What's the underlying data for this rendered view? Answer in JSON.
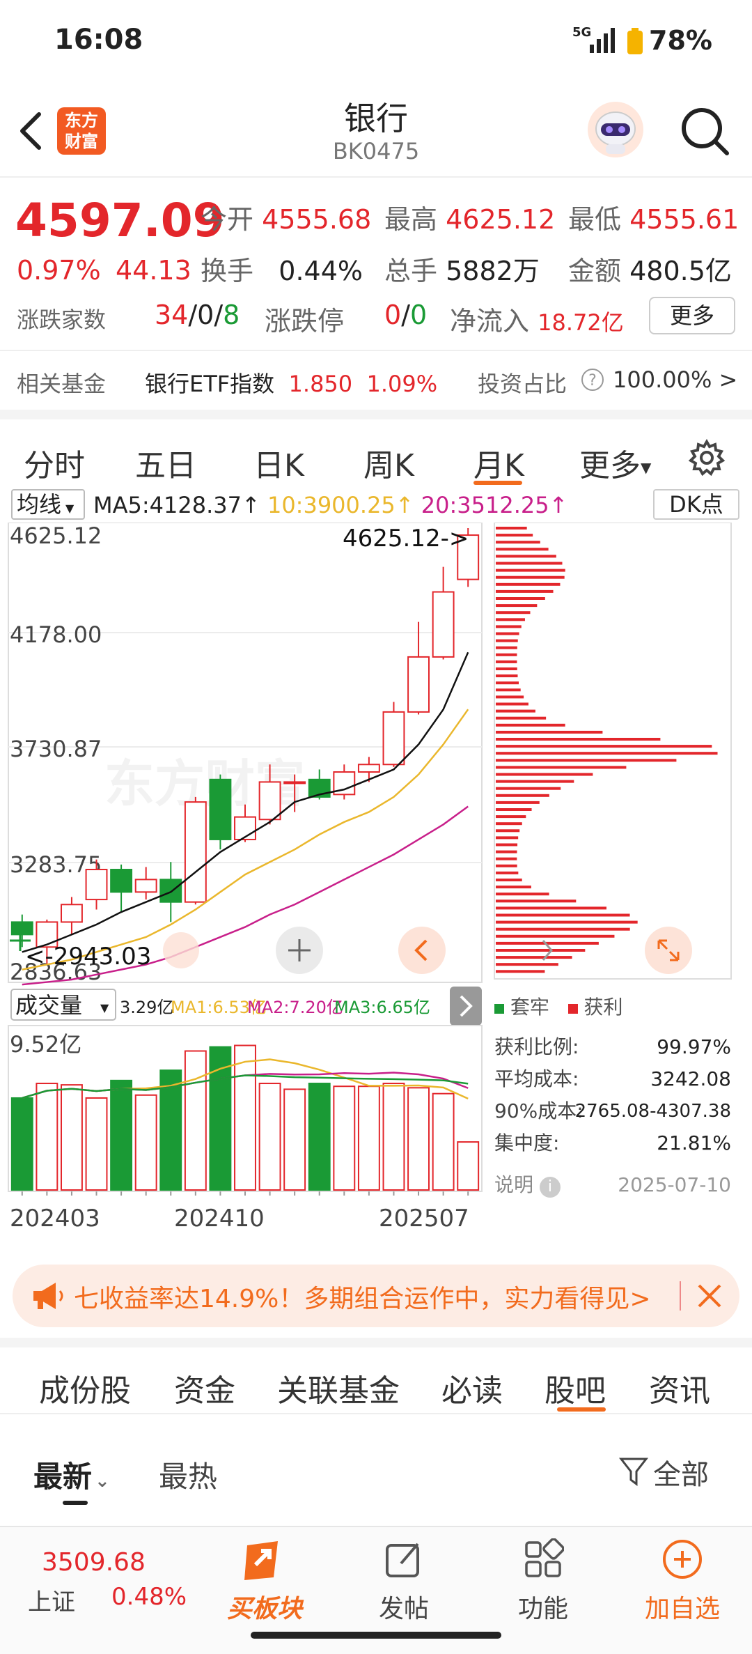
{
  "status": {
    "time": "16:08",
    "network": "5G",
    "battery": "78%"
  },
  "nav": {
    "title": "银行",
    "code": "BK0475",
    "logo_line1": "东方",
    "logo_line2": "财富"
  },
  "quote": {
    "price": "4597.09",
    "pct": "0.97%",
    "chg": "44.13",
    "open_label": "今开",
    "open": "4555.68",
    "high_label": "最高",
    "high": "4625.12",
    "low_label": "最低",
    "low": "4555.61",
    "turnover_label": "换手",
    "turnover": "0.44%",
    "volume_label": "总手",
    "volume": "5882万",
    "amount_label": "金额",
    "amount": "480.5亿",
    "breadth_label": "涨跌家数",
    "breadth_up": "34",
    "breadth_flat": "0",
    "breadth_down": "8",
    "breadth_sep": "/",
    "limit_label": "涨跌停",
    "limit_up": "0",
    "limit_down": "0",
    "inflow_label": "净流入",
    "inflow": "18.72亿",
    "more_btn": "更多",
    "fund_label": "相关基金",
    "fund_name": "银行ETF指数",
    "fund_price": "1.850",
    "fund_pct": "1.09%",
    "ratio_label": "投资占比",
    "ratio_value": "100.00% >"
  },
  "tabs": {
    "items": [
      "分时",
      "五日",
      "日K",
      "周K",
      "月K",
      "更多"
    ],
    "active": "月K"
  },
  "chart_header": {
    "ma_select": "均线",
    "ma5": "MA5:4128.37",
    "ma10": "10:3900.25",
    "ma20": "20:3512.25",
    "dk_btn": "DK点"
  },
  "vol_header": {
    "select": "成交量",
    "v": "3.29亿",
    "ma1": "MA1:6.53亿",
    "ma2": "MA2:7.20亿",
    "ma3": "MA3:6.65亿"
  },
  "price_axis": {
    "p1": "4625.12",
    "p2": "4178.00",
    "p3": "3730.87",
    "p4": "3283.75",
    "p5": "2836.63",
    "high_mark": "4625.12->",
    "low_mark": "<-2943.03"
  },
  "vol_axis": {
    "max": "9.52亿"
  },
  "date_axis": [
    "202403",
    "202410",
    "202507"
  ],
  "chip": {
    "legend_trap": "套牢",
    "legend_profit": "获利",
    "rows": [
      {
        "label": "获利比例:",
        "value": "99.97%"
      },
      {
        "label": "平均成本:",
        "value": "3242.08"
      },
      {
        "label": "90%成本:",
        "value": "2765.08-4307.38"
      },
      {
        "label": "集中度:",
        "value": "21.81%"
      }
    ],
    "note_label": "说明",
    "date": "2025-07-10"
  },
  "ticker": {
    "text": "七收益率达14.9%！多期组合运作中，实力看得见>"
  },
  "bottom_tabs": {
    "items": [
      "成份股",
      "资金",
      "关联基金",
      "必读",
      "股吧",
      "资讯"
    ],
    "active": "股吧"
  },
  "sub_tabs": {
    "latest": "最新",
    "hot": "最热",
    "filter": "全部"
  },
  "bottom_nav": {
    "index_value": "3509.68",
    "index_name": "上证",
    "index_pct": "0.48%",
    "buy": "买板块",
    "post": "发帖",
    "func": "功能",
    "add": "加自选"
  },
  "chart_data": {
    "type": "candlestick",
    "y_range": [
      2836.63,
      4625.12
    ],
    "candles": [
      {
        "o": 3050,
        "c": 3000,
        "h": 3080,
        "l": 2950
      },
      {
        "o": 2950,
        "c": 3050,
        "h": 3060,
        "l": 2880
      },
      {
        "o": 3050,
        "c": 3120,
        "h": 3150,
        "l": 3000
      },
      {
        "o": 3140,
        "c": 3260,
        "h": 3300,
        "l": 3100
      },
      {
        "o": 3260,
        "c": 3170,
        "h": 3280,
        "l": 3090
      },
      {
        "o": 3170,
        "c": 3220,
        "h": 3270,
        "l": 3140
      },
      {
        "o": 3220,
        "c": 3130,
        "h": 3290,
        "l": 3050
      },
      {
        "o": 3130,
        "c": 3530,
        "h": 3550,
        "l": 3120
      },
      {
        "o": 3620,
        "c": 3380,
        "h": 3640,
        "l": 3340
      },
      {
        "o": 3380,
        "c": 3470,
        "h": 3520,
        "l": 3370
      },
      {
        "o": 3460,
        "c": 3610,
        "h": 3680,
        "l": 3440
      },
      {
        "o": 3610,
        "c": 3610,
        "h": 3640,
        "l": 3490
      },
      {
        "o": 3620,
        "c": 3550,
        "h": 3660,
        "l": 3540
      },
      {
        "o": 3560,
        "c": 3650,
        "h": 3680,
        "l": 3540
      },
      {
        "o": 3650,
        "c": 3680,
        "h": 3710,
        "l": 3610
      },
      {
        "o": 3680,
        "c": 3890,
        "h": 3930,
        "l": 3670
      },
      {
        "o": 3890,
        "c": 4110,
        "h": 4250,
        "l": 3880
      },
      {
        "o": 4110,
        "c": 4370,
        "h": 4470,
        "l": 4100
      },
      {
        "o": 4420,
        "c": 4597.09,
        "h": 4625.12,
        "l": 4390
      }
    ],
    "ma5": [
      2930,
      2960,
      3000,
      3040,
      3090,
      3130,
      3170,
      3250,
      3330,
      3390,
      3450,
      3530,
      3560,
      3580,
      3620,
      3660,
      3760,
      3900,
      4128.37
    ],
    "ma10": [
      2860,
      2880,
      2900,
      2930,
      2960,
      2990,
      3040,
      3100,
      3170,
      3240,
      3290,
      3340,
      3400,
      3450,
      3490,
      3550,
      3640,
      3760,
      3900.25
    ],
    "ma20": [
      2800,
      2810,
      2820,
      2840,
      2860,
      2880,
      2910,
      2950,
      2990,
      3030,
      3080,
      3120,
      3170,
      3220,
      3270,
      3320,
      3380,
      3440,
      3512.25
    ],
    "volume": [
      6.3,
      7.3,
      7.2,
      6.3,
      7.5,
      6.5,
      8.2,
      9.52,
      9.8,
      9.9,
      7.3,
      6.9,
      7.3,
      7.1,
      7.1,
      7.3,
      7.0,
      6.6,
      3.29
    ],
    "vol_range": [
      0,
      9.52
    ]
  }
}
